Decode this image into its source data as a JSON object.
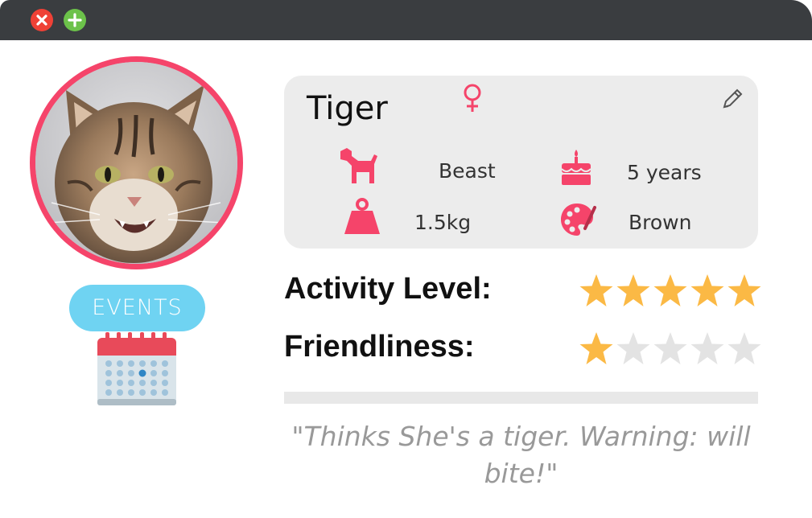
{
  "window": {
    "close_icon": "close-icon",
    "add_icon": "plus-icon"
  },
  "profile": {
    "photo_icon": "cat-photo",
    "events_label": "EVENTS",
    "calendar_icon": "calendar-icon"
  },
  "info": {
    "name": "Tiger",
    "gender_icon": "female-icon",
    "edit_icon": "pencil-icon",
    "breed": "Beast",
    "age": "5 years",
    "weight": "1.5kg",
    "color": "Brown"
  },
  "ratings": {
    "activity_label": "Activity Level:",
    "activity_value": 5,
    "friendliness_label": "Friendliness:",
    "friendliness_value": 1,
    "max": 5
  },
  "quote": "\"Thinks She's a tiger. Warning: will bite!\"",
  "colors": {
    "accent": "#f5446a",
    "star_filled": "#fbb945",
    "star_empty": "#e3e3e3",
    "events_button": "#6fd3f2",
    "titlebar": "#3a3d40"
  }
}
